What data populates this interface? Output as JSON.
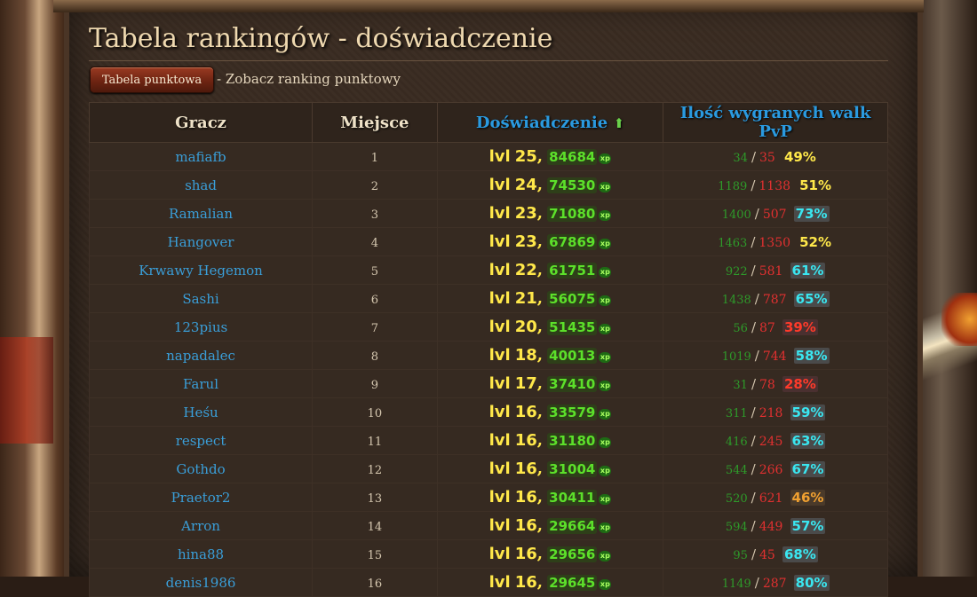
{
  "page": {
    "title": "Tabela rankingów - doświadczenie",
    "ranking_button_label": "Tabela punktowa",
    "ranking_button_desc": "- Zobacz ranking punktowy"
  },
  "table": {
    "headers": {
      "player": "Gracz",
      "place": "Miejsce",
      "experience": "Doświadczenie",
      "pvp": "Ilość wygranych walk PvP"
    },
    "sort_arrow": "⬆",
    "xp_icon_label": "xp",
    "separator": "/",
    "comma": ",",
    "lvl_prefix": "lvl",
    "rows": [
      {
        "player": "mafiafb",
        "place": "1",
        "lvl": "25",
        "exp": "84684",
        "wins": "34",
        "losses": "35",
        "pct": "49%",
        "pct_color": "#ffe84a",
        "pct_bg": "transparent"
      },
      {
        "player": "shad",
        "place": "2",
        "lvl": "24",
        "exp": "74530",
        "wins": "1189",
        "losses": "1138",
        "pct": "51%",
        "pct_color": "#ffe84a",
        "pct_bg": "transparent"
      },
      {
        "player": "Ramalian",
        "place": "3",
        "lvl": "23",
        "exp": "71080",
        "wins": "1400",
        "losses": "507",
        "pct": "73%",
        "pct_color": "#3ae6f0",
        "pct_bg": "#4a4a4a"
      },
      {
        "player": "Hangover",
        "place": "4",
        "lvl": "23",
        "exp": "67869",
        "wins": "1463",
        "losses": "1350",
        "pct": "52%",
        "pct_color": "#ffe84a",
        "pct_bg": "transparent"
      },
      {
        "player": "Krwawy Hegemon",
        "place": "5",
        "lvl": "22",
        "exp": "61751",
        "wins": "922",
        "losses": "581",
        "pct": "61%",
        "pct_color": "#3ae6f0",
        "pct_bg": "#4a4a4a"
      },
      {
        "player": "Sashi",
        "place": "6",
        "lvl": "21",
        "exp": "56075",
        "wins": "1438",
        "losses": "787",
        "pct": "65%",
        "pct_color": "#3ae6f0",
        "pct_bg": "#4a4a4a"
      },
      {
        "player": "123pius",
        "place": "7",
        "lvl": "20",
        "exp": "51435",
        "wins": "56",
        "losses": "87",
        "pct": "39%",
        "pct_color": "#ff3a2a",
        "pct_bg": "#4a3030"
      },
      {
        "player": "napadalec",
        "place": "8",
        "lvl": "18",
        "exp": "40013",
        "wins": "1019",
        "losses": "744",
        "pct": "58%",
        "pct_color": "#3ae6f0",
        "pct_bg": "#4a4a4a"
      },
      {
        "player": "Farul",
        "place": "9",
        "lvl": "17",
        "exp": "37410",
        "wins": "31",
        "losses": "78",
        "pct": "28%",
        "pct_color": "#ff3a2a",
        "pct_bg": "#4a3030"
      },
      {
        "player": "Heśu",
        "place": "10",
        "lvl": "16",
        "exp": "33579",
        "wins": "311",
        "losses": "218",
        "pct": "59%",
        "pct_color": "#3ae6f0",
        "pct_bg": "#4a4a4a"
      },
      {
        "player": "respect",
        "place": "11",
        "lvl": "16",
        "exp": "31180",
        "wins": "416",
        "losses": "245",
        "pct": "63%",
        "pct_color": "#3ae6f0",
        "pct_bg": "#4a4a4a"
      },
      {
        "player": "Gothdo",
        "place": "12",
        "lvl": "16",
        "exp": "31004",
        "wins": "544",
        "losses": "266",
        "pct": "67%",
        "pct_color": "#3ae6f0",
        "pct_bg": "#4a4a4a"
      },
      {
        "player": "Praetor2",
        "place": "13",
        "lvl": "16",
        "exp": "30411",
        "wins": "520",
        "losses": "621",
        "pct": "46%",
        "pct_color": "#f0a030",
        "pct_bg": "#4a3a2a"
      },
      {
        "player": "Arron",
        "place": "14",
        "lvl": "16",
        "exp": "29664",
        "wins": "594",
        "losses": "449",
        "pct": "57%",
        "pct_color": "#3ae6f0",
        "pct_bg": "#4a4a4a"
      },
      {
        "player": "hina88",
        "place": "15",
        "lvl": "16",
        "exp": "29656",
        "wins": "95",
        "losses": "45",
        "pct": "68%",
        "pct_color": "#3ae6f0",
        "pct_bg": "#4a4a4a"
      },
      {
        "player": "denis1986",
        "place": "16",
        "lvl": "16",
        "exp": "29645",
        "wins": "1149",
        "losses": "287",
        "pct": "80%",
        "pct_color": "#3ae6f0",
        "pct_bg": "#4a4a4a"
      }
    ]
  }
}
